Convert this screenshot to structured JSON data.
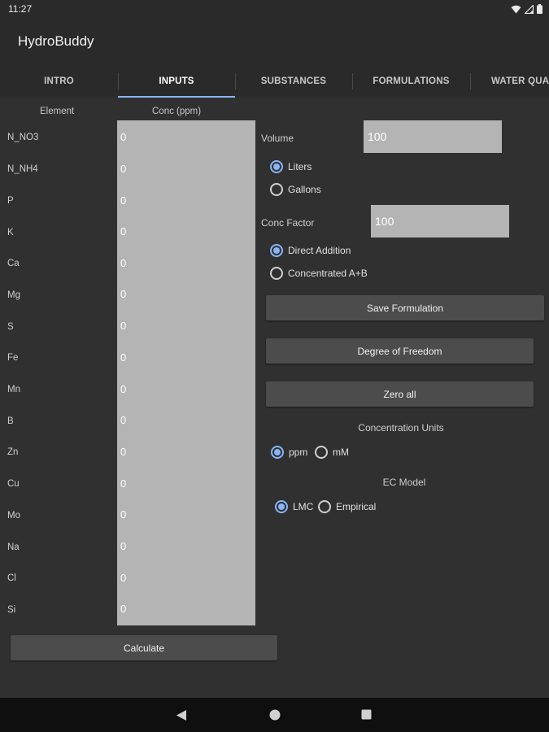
{
  "status": {
    "time": "11:27"
  },
  "app": {
    "title": "HydroBuddy"
  },
  "tabs": [
    {
      "label": "INTRO"
    },
    {
      "label": "INPUTS"
    },
    {
      "label": "SUBSTANCES"
    },
    {
      "label": "FORMULATIONS"
    },
    {
      "label": "WATER QUAL"
    }
  ],
  "table": {
    "element_header": "Element",
    "conc_header": "Conc (ppm)",
    "rows": [
      {
        "element": "N_NO3",
        "value": "0"
      },
      {
        "element": "N_NH4",
        "value": "0"
      },
      {
        "element": "P",
        "value": "0"
      },
      {
        "element": "K",
        "value": "0"
      },
      {
        "element": "Ca",
        "value": "0"
      },
      {
        "element": "Mg",
        "value": "0"
      },
      {
        "element": "S",
        "value": "0"
      },
      {
        "element": "Fe",
        "value": "0"
      },
      {
        "element": "Mn",
        "value": "0"
      },
      {
        "element": "B",
        "value": "0"
      },
      {
        "element": "Zn",
        "value": "0"
      },
      {
        "element": "Cu",
        "value": "0"
      },
      {
        "element": "Mo",
        "value": "0"
      },
      {
        "element": "Na",
        "value": "0"
      },
      {
        "element": "Cl",
        "value": "0"
      },
      {
        "element": "Si",
        "value": "0"
      }
    ]
  },
  "volume": {
    "label": "Volume",
    "value": "100"
  },
  "units": {
    "liters": "Liters",
    "gallons": "Gallons",
    "selected": "Liters"
  },
  "conc_factor": {
    "label": "Conc Factor",
    "value": "100"
  },
  "addition": {
    "direct": "Direct Addition",
    "concentrated": "Concentrated A+B",
    "selected": "Direct Addition"
  },
  "buttons": {
    "save": "Save Formulation",
    "dof": "Degree of Freedom",
    "zero": "Zero all",
    "calculate": "Calculate"
  },
  "concentration_units": {
    "label": "Concentration Units",
    "ppm": "ppm",
    "mm": "mM",
    "selected": "ppm"
  },
  "ec_model": {
    "label": "EC Model",
    "lmc": "LMC",
    "empirical": "Empirical",
    "selected": "LMC"
  },
  "colors": {
    "accent": "#8ab4f8",
    "background": "#303030",
    "field": "#b4b4b4",
    "button": "#4c4c4c"
  },
  "icons": [
    "wifi-icon",
    "signal-icon",
    "battery-icon",
    "back-icon",
    "home-icon",
    "recents-icon"
  ]
}
